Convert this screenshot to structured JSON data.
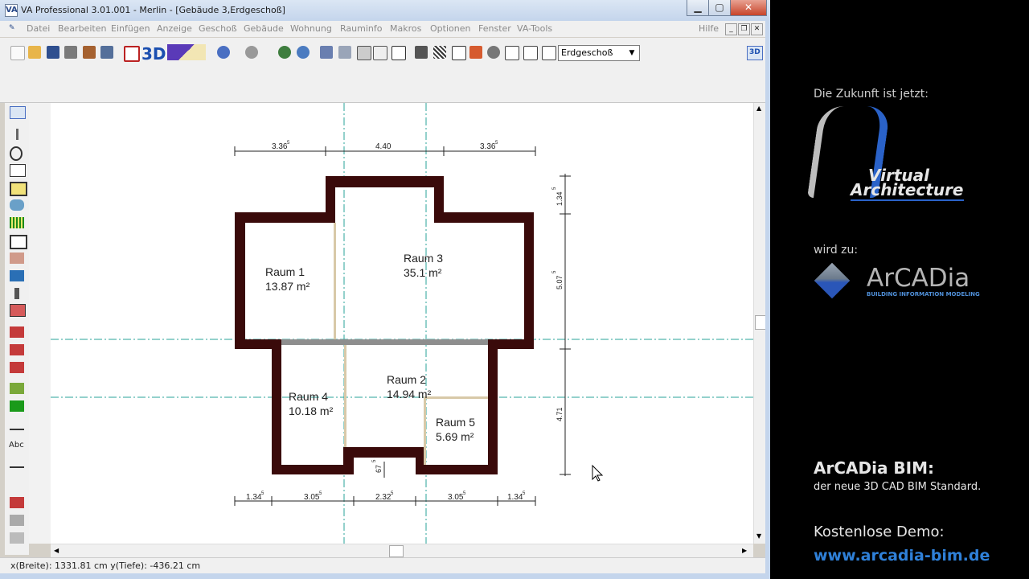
{
  "window": {
    "title": "VA Professional  3.01.001 - Merlin - [Gebäude 3,Erdgeschoß]",
    "app_icon": "VA",
    "minimize_icon": "minimize-icon",
    "maximize_icon": "maximize-icon",
    "close_icon": "close-icon"
  },
  "menu": {
    "items": [
      "Datei",
      "Bearbeiten",
      "Einfügen",
      "Anzeige",
      "Geschoß",
      "Gebäude",
      "Wohnung",
      "Rauminfo",
      "Makros",
      "Optionen",
      "Fenster",
      "VA-Tools"
    ],
    "help": "Hilfe"
  },
  "toolbar": {
    "floor_select_value": "Erdgeschoß",
    "view_3d_label": "3D",
    "view_3d_small": "3D"
  },
  "drawing": {
    "dims_top": [
      "3.36",
      "5",
      "4.40",
      "3.36",
      "5"
    ],
    "dims_bottom": [
      "1.34",
      "5",
      "3.05",
      "5",
      "2.32",
      "5",
      "3.05",
      "5",
      "1.34",
      "5"
    ],
    "dims_right": [
      "1.34",
      "5",
      "5.07",
      "5",
      "4.71"
    ],
    "door_dim": "67",
    "door_dim_sup": "5",
    "rooms": [
      {
        "name": "Raum 1",
        "area": "13.87 m²"
      },
      {
        "name": "Raum 3",
        "area": "35.1 m²"
      },
      {
        "name": "Raum 2",
        "area": "14.94 m²"
      },
      {
        "name": "Raum 4",
        "area": "10.18 m²"
      },
      {
        "name": "Raum 5",
        "area": "5.69 m²"
      }
    ]
  },
  "status": {
    "coords": "x(Breite): 1331.81 cm  y(Tiefe): -436.21 cm"
  },
  "ad": {
    "intro": "Die Zukunft ist jetzt:",
    "va_line1": "Virtual",
    "va_line2": "Architecture",
    "becomes": "wird zu:",
    "arcadia": "ArCADia",
    "arcadia_sub": "BUILDING INFORMATION MODELING",
    "headline": "ArCADia BIM:",
    "subline": "der neue 3D CAD BIM Standard.",
    "demo": "Kostenlose Demo:",
    "url": "www.arcadia-bim.de",
    "colors": {
      "url": "#2f80d8",
      "wall": "#3a0a0a",
      "axis": "#2aa39a"
    }
  }
}
